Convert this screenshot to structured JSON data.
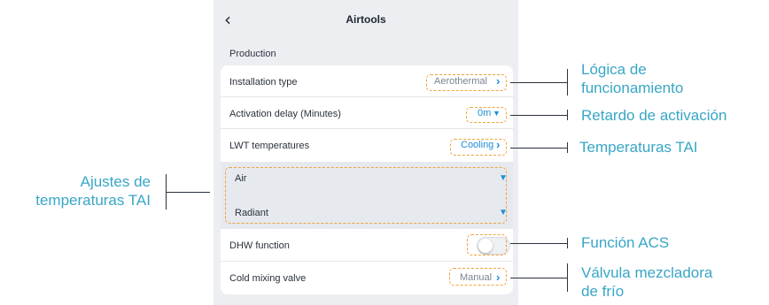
{
  "app": {
    "back_icon": "chevron-left-icon",
    "title": "Airtools"
  },
  "section": {
    "title": "Production"
  },
  "rows": {
    "installation_type": {
      "label": "Installation type",
      "value": "Aerothermal",
      "icon": "chevron-right-icon"
    },
    "activation_delay": {
      "label": "Activation delay (Minutes)",
      "value": "0m",
      "icon": "chevron-down-icon"
    },
    "lwt_temperatures": {
      "label": "LWT temperatures",
      "value": "Cooling",
      "icon": "chevron-right-icon"
    },
    "air": {
      "label": "Air",
      "icon": "chevron-down-icon"
    },
    "radiant": {
      "label": "Radiant",
      "icon": "chevron-down-icon"
    },
    "dhw_function": {
      "label": "DHW function",
      "toggle_on": false
    },
    "cold_mixing_valve": {
      "label": "Cold mixing valve",
      "value": "Manual",
      "icon": "chevron-right-icon"
    }
  },
  "annotations": {
    "logica": [
      "Lógica de",
      "funcionamiento"
    ],
    "retardo": "Retardo de activación",
    "temperaturas": "Temperaturas TAI",
    "ajustes": [
      "Ajustes de",
      "temperaturas TAI"
    ],
    "funcion_acs": "Función ACS",
    "valvula": [
      "Válvula mezcladora",
      "de frío"
    ]
  },
  "colors": {
    "accent_blue": "#1e8fd6",
    "highlight_orange": "#f0a33a",
    "annotation_teal": "#38a6c6",
    "screen_bg": "#eceef2"
  }
}
